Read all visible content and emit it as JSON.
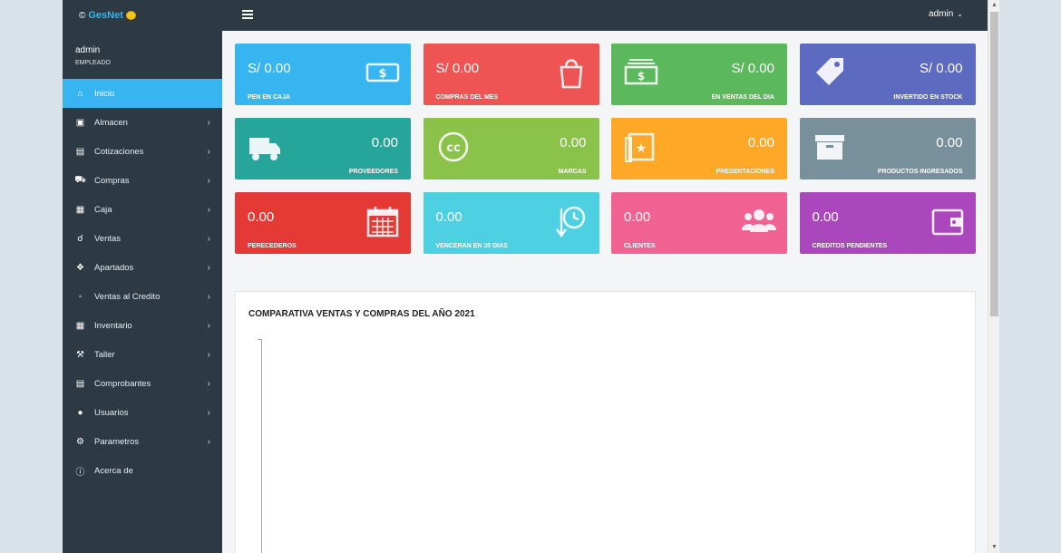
{
  "brand": {
    "prefix": "©",
    "name": "GesNet"
  },
  "topbar": {
    "user": "admin"
  },
  "profile": {
    "name": "admin",
    "role": "EMPLEADO"
  },
  "sidebar": {
    "items": [
      {
        "label": "Inicio",
        "icon": "home-icon",
        "active": true,
        "has_submenu": false
      },
      {
        "label": "Almacen",
        "icon": "archive-icon",
        "active": false,
        "has_submenu": true
      },
      {
        "label": "Cotizaciones",
        "icon": "document-icon",
        "active": false,
        "has_submenu": true
      },
      {
        "label": "Compras",
        "icon": "truck-icon",
        "active": false,
        "has_submenu": true
      },
      {
        "label": "Caja",
        "icon": "cash-register-icon",
        "active": false,
        "has_submenu": true
      },
      {
        "label": "Ventas",
        "icon": "cart-icon",
        "active": false,
        "has_submenu": true
      },
      {
        "label": "Apartados",
        "icon": "tag-icon",
        "active": false,
        "has_submenu": true
      },
      {
        "label": "Ventas al Credito",
        "icon": "credit-icon",
        "active": false,
        "has_submenu": true
      },
      {
        "label": "Inventario",
        "icon": "grid-icon",
        "active": false,
        "has_submenu": true
      },
      {
        "label": "Taller",
        "icon": "tools-icon",
        "active": false,
        "has_submenu": true
      },
      {
        "label": "Comprobantes",
        "icon": "receipt-icon",
        "active": false,
        "has_submenu": true
      },
      {
        "label": "Usuarios",
        "icon": "user-icon",
        "active": false,
        "has_submenu": true
      },
      {
        "label": "Parametros",
        "icon": "gear-icon",
        "active": false,
        "has_submenu": true
      },
      {
        "label": "Acerca de",
        "icon": "info-icon",
        "active": false,
        "has_submenu": false
      }
    ]
  },
  "cards": [
    {
      "value": "S/ 0.00",
      "label": "PEN EN CAJA",
      "color": "#36b5f0",
      "icon": "money-icon"
    },
    {
      "value": "S/ 0.00",
      "label": "COMPRAS DEL MES",
      "color": "#ee5454",
      "icon": "shopping-bag-icon"
    },
    {
      "value": "S/ 0.00",
      "label": "EN VENTAS DEL DIA",
      "color": "#5cb85c",
      "icon": "money-stack-icon"
    },
    {
      "value": "S/ 0.00",
      "label": "INVERTIDO EN STOCK",
      "color": "#5c6bc0",
      "icon": "tags-icon"
    },
    {
      "value": "0.00",
      "label": "PROVEEDORES",
      "color": "#26a69a",
      "icon": "truck-icon"
    },
    {
      "value": "0.00",
      "label": "MARCAS",
      "color": "#8bc34a",
      "icon": "creative-commons-icon"
    },
    {
      "value": "0.00",
      "label": "PRESENTACIONES",
      "color": "#ffa726",
      "icon": "photo-star-icon"
    },
    {
      "value": "0.00",
      "label": "PRODUCTOS INGRESADOS",
      "color": "#78909c",
      "icon": "archive-box-icon"
    },
    {
      "value": "0.00",
      "label": "PERECEDEROS",
      "color": "#e53935",
      "icon": "calendar-icon"
    },
    {
      "value": "0.00",
      "label": "VENCERAN EN 30 DIAS",
      "color": "#4dd0e1",
      "icon": "history-icon"
    },
    {
      "value": "0.00",
      "label": "CLIENTES",
      "color": "#f06292",
      "icon": "users-icon"
    },
    {
      "value": "0.00",
      "label": "CREDITOS PENDIENTES",
      "color": "#ab47bc",
      "icon": "wallet-icon"
    }
  ],
  "chart_panel": {
    "title": "COMPARATIVA VENTAS Y COMPRAS DEL AÑO 2021"
  }
}
